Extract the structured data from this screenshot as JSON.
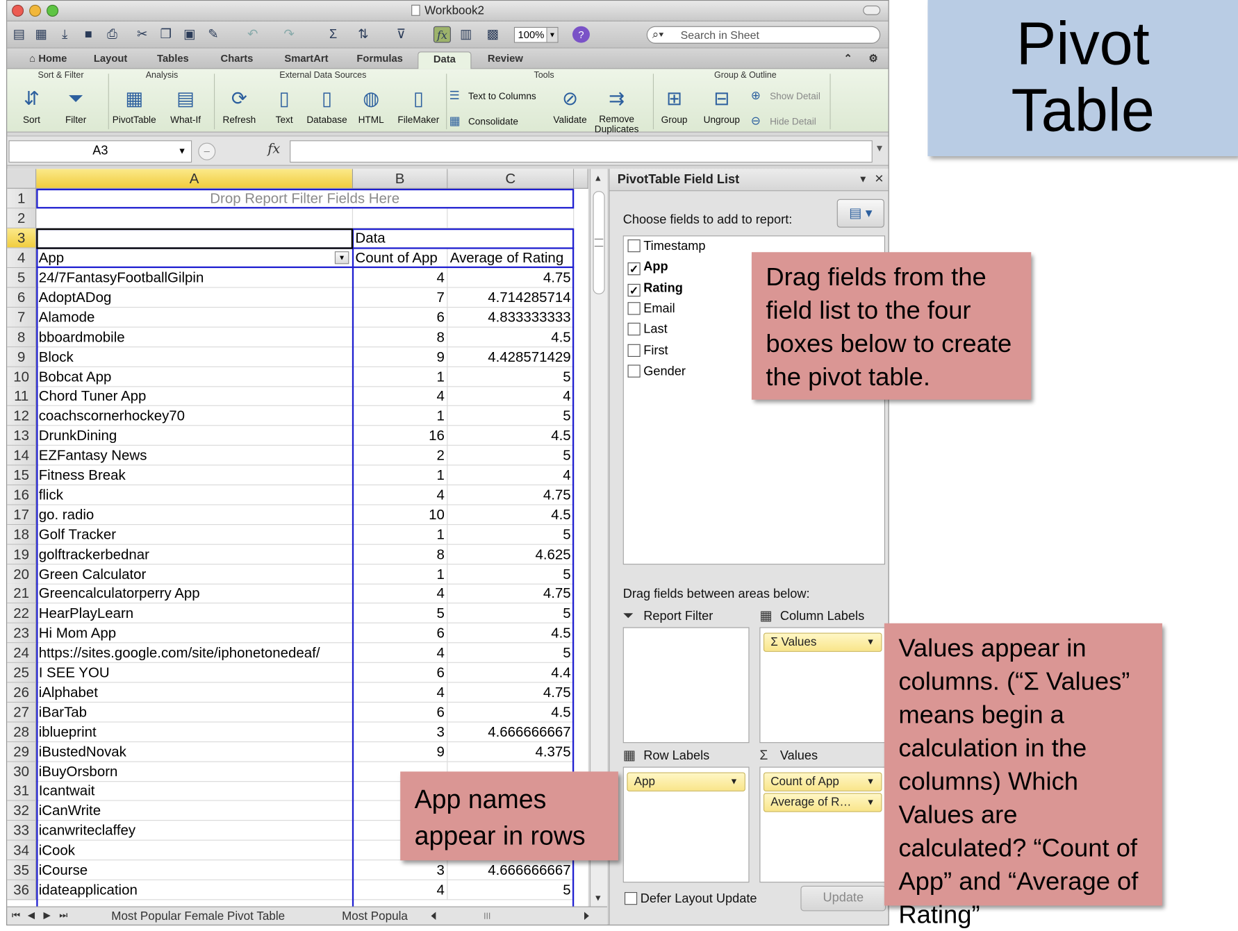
{
  "window": {
    "title": "Workbook2"
  },
  "toolbar": {
    "zoom": "100%",
    "search_placeholder": "Search in Sheet"
  },
  "tabs": [
    "Home",
    "Layout",
    "Tables",
    "Charts",
    "SmartArt",
    "Formulas",
    "Data",
    "Review"
  ],
  "active_tab": "Data",
  "ribbon": {
    "groups": {
      "sort_filter": "Sort & Filter",
      "analysis": "Analysis",
      "external": "External Data Sources",
      "tools": "Tools",
      "group_outline": "Group & Outline"
    },
    "buttons": {
      "sort": "Sort",
      "filter": "Filter",
      "pivottable": "PivotTable",
      "whatif": "What-If",
      "refresh": "Refresh",
      "text": "Text",
      "database": "Database",
      "html": "HTML",
      "filemaker": "FileMaker",
      "text_to_columns": "Text to Columns",
      "consolidate": "Consolidate",
      "validate": "Validate",
      "remove_dup_1": "Remove",
      "remove_dup_2": "Duplicates",
      "group": "Group",
      "ungroup": "Ungroup",
      "show_detail": "Show Detail",
      "hide_detail": "Hide Detail"
    }
  },
  "formula_bar": {
    "name_box": "A3",
    "formula": ""
  },
  "grid": {
    "columns": [
      "A",
      "B",
      "C"
    ],
    "row1_placeholder": "Drop Report Filter Fields Here",
    "data_label": "Data",
    "headers": {
      "a": "App",
      "b": "Count of App",
      "c": "Average of Rating"
    },
    "rows": [
      {
        "n": "5",
        "app": "24/7FantasyFootballGilpin",
        "count": "4",
        "avg": "4.75"
      },
      {
        "n": "6",
        "app": "AdoptADog",
        "count": "7",
        "avg": "4.714285714"
      },
      {
        "n": "7",
        "app": "Alamode",
        "count": "6",
        "avg": "4.833333333"
      },
      {
        "n": "8",
        "app": "bboardmobile",
        "count": "8",
        "avg": "4.5"
      },
      {
        "n": "9",
        "app": "Block",
        "count": "9",
        "avg": "4.428571429"
      },
      {
        "n": "10",
        "app": "Bobcat App",
        "count": "1",
        "avg": "5"
      },
      {
        "n": "11",
        "app": "Chord Tuner App",
        "count": "4",
        "avg": "4"
      },
      {
        "n": "12",
        "app": "coachscornerhockey70",
        "count": "1",
        "avg": "5"
      },
      {
        "n": "13",
        "app": "DrunkDining",
        "count": "16",
        "avg": "4.5"
      },
      {
        "n": "14",
        "app": "EZFantasy News",
        "count": "2",
        "avg": "5"
      },
      {
        "n": "15",
        "app": "Fitness Break",
        "count": "1",
        "avg": "4"
      },
      {
        "n": "16",
        "app": "flick",
        "count": "4",
        "avg": "4.75"
      },
      {
        "n": "17",
        "app": "go. radio",
        "count": "10",
        "avg": "4.5"
      },
      {
        "n": "18",
        "app": "Golf Tracker",
        "count": "1",
        "avg": "5"
      },
      {
        "n": "19",
        "app": "golftrackerbednar",
        "count": "8",
        "avg": "4.625"
      },
      {
        "n": "20",
        "app": "Green Calculator",
        "count": "1",
        "avg": "5"
      },
      {
        "n": "21",
        "app": "Greencalculatorperry App",
        "count": "4",
        "avg": "4.75"
      },
      {
        "n": "22",
        "app": "HearPlayLearn",
        "count": "5",
        "avg": "5"
      },
      {
        "n": "23",
        "app": "Hi Mom App",
        "count": "6",
        "avg": "4.5"
      },
      {
        "n": "24",
        "app": "https://sites.google.com/site/iphonetonedeaf/",
        "count": "4",
        "avg": "5"
      },
      {
        "n": "25",
        "app": "I SEE YOU",
        "count": "6",
        "avg": "4.4"
      },
      {
        "n": "26",
        "app": "iAlphabet",
        "count": "4",
        "avg": "4.75"
      },
      {
        "n": "27",
        "app": "iBarTab",
        "count": "6",
        "avg": "4.5"
      },
      {
        "n": "28",
        "app": "iblueprint",
        "count": "3",
        "avg": "4.666666667"
      },
      {
        "n": "29",
        "app": "iBustedNovak",
        "count": "9",
        "avg": "4.375"
      },
      {
        "n": "30",
        "app": "iBuyOrsborn",
        "count": "",
        "avg": ""
      },
      {
        "n": "31",
        "app": "Icantwait",
        "count": "",
        "avg": ""
      },
      {
        "n": "32",
        "app": "iCanWrite",
        "count": "",
        "avg": ""
      },
      {
        "n": "33",
        "app": "icanwriteclaffey",
        "count": "",
        "avg": ""
      },
      {
        "n": "34",
        "app": "iCook",
        "count": "",
        "avg": ""
      },
      {
        "n": "35",
        "app": "iCourse",
        "count": "3",
        "avg": "4.666666667"
      },
      {
        "n": "36",
        "app": "idateapplication",
        "count": "4",
        "avg": "5"
      }
    ]
  },
  "sheet_tabs": [
    "Most Popular Female Pivot Table",
    "Most Popula"
  ],
  "field_list": {
    "title": "PivotTable Field List",
    "choose_label": "Choose fields to add to report:",
    "fields": [
      {
        "name": "Timestamp",
        "checked": false
      },
      {
        "name": "App",
        "checked": true
      },
      {
        "name": "Rating",
        "checked": true
      },
      {
        "name": "Email",
        "checked": false
      },
      {
        "name": "Last",
        "checked": false
      },
      {
        "name": "First",
        "checked": false
      },
      {
        "name": "Gender",
        "checked": false
      }
    ],
    "drag_label": "Drag fields between areas below:",
    "areas": {
      "report_filter": "Report Filter",
      "column_labels": "Column Labels",
      "row_labels": "Row Labels",
      "values": "Values"
    },
    "chips": {
      "column_values": "Σ Values",
      "row_app": "App",
      "count_app": "Count of App",
      "avg_rating": "Average of R…"
    },
    "defer_label": "Defer Layout Update",
    "update_label": "Update"
  },
  "annotations": {
    "title_line1": "Pivot",
    "title_line2": "Table",
    "fields_callout": "Drag fields from the field list to the four boxes below to create the pivot table.",
    "values_callout": "Values appear in columns.  (“Σ Values” means begin a calculation in the columns)  Which Values are calculated? “Count of App” and “Average of Rating”",
    "rows_callout": "App names appear in rows"
  },
  "colors": {
    "pivot_border": "#1f1fd1",
    "callout": "#da9694",
    "title_box": "#b9cce4",
    "chip": "#f9e58a"
  }
}
